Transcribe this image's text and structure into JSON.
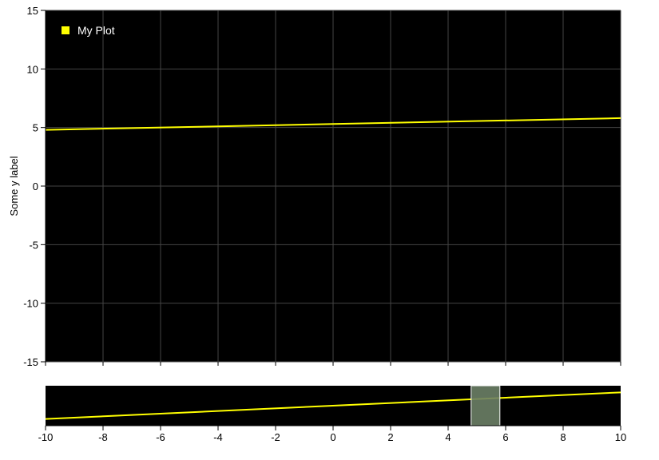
{
  "chart_data": [
    {
      "type": "line",
      "title": "",
      "ylabel": "Some y label",
      "xlabel": "",
      "xlim": [
        -10,
        10
      ],
      "ylim": [
        -15,
        15
      ],
      "x_ticks": [
        -10,
        -8,
        -6,
        -4,
        -2,
        0,
        2,
        4,
        6,
        8,
        10
      ],
      "y_ticks": [
        15,
        10,
        5,
        0,
        -5,
        -10,
        -15
      ],
      "x_tick_labels_visible": false,
      "grid": true,
      "background": "#000000",
      "legend": {
        "position": "top-left",
        "entries": [
          {
            "name": "My Plot",
            "color": "#ffff00"
          }
        ]
      },
      "series": [
        {
          "name": "My Plot",
          "color": "#ffff00",
          "x": [
            -10,
            10
          ],
          "y": [
            4.8,
            5.8
          ]
        }
      ]
    },
    {
      "type": "line",
      "role": "overview",
      "xlim": [
        -10,
        10
      ],
      "x_ticks": [
        -10,
        -8,
        -6,
        -4,
        -2,
        0,
        2,
        4,
        6,
        8,
        10
      ],
      "background": "#000000",
      "y_ticks_visible": false,
      "series": [
        {
          "color": "#ffff00",
          "x": [
            -10,
            10
          ],
          "y": [
            4.8,
            5.8
          ]
        }
      ],
      "selection": {
        "x": [
          4.8,
          5.8
        ],
        "color": "#6b8066"
      }
    }
  ]
}
